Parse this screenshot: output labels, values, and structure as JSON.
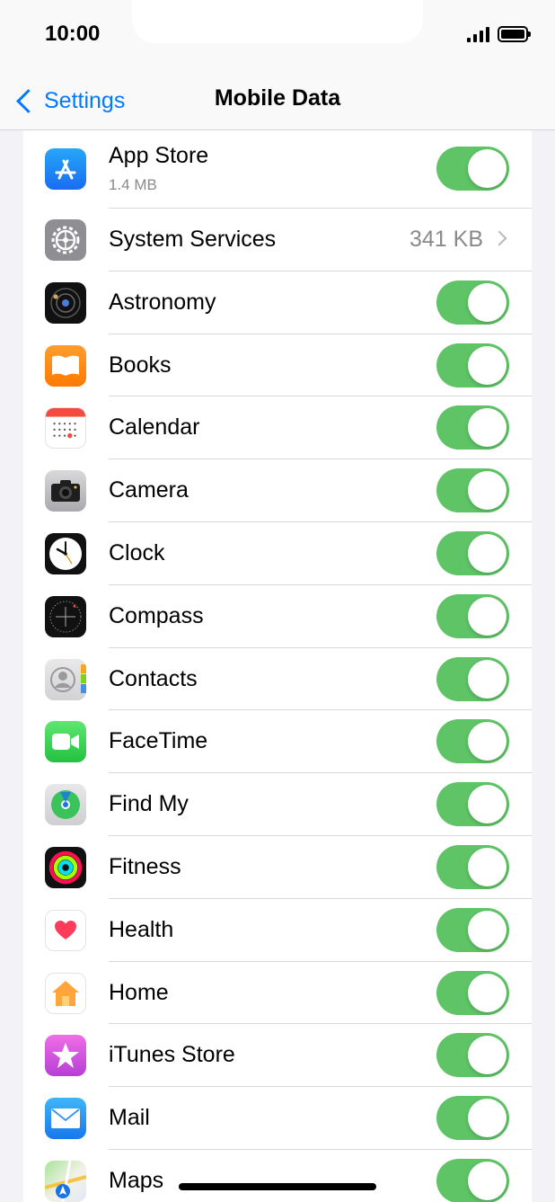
{
  "status_bar": {
    "time": "10:00"
  },
  "nav": {
    "back_label": "Settings",
    "title": "Mobile Data"
  },
  "colors": {
    "accent": "#007aff",
    "toggle_on": "#5ec466",
    "secondary_text": "#8a8a8e"
  },
  "rows": [
    {
      "name": "App Store",
      "subtitle": "1.4 MB",
      "icon": "app-store-icon",
      "control": "toggle",
      "on": true
    },
    {
      "name": "System Services",
      "detail": "341 KB",
      "icon": "system-services-gear-icon",
      "control": "disclosure"
    },
    {
      "name": "Astronomy",
      "icon": "astronomy-icon",
      "control": "toggle",
      "on": true
    },
    {
      "name": "Books",
      "icon": "books-icon",
      "control": "toggle",
      "on": true
    },
    {
      "name": "Calendar",
      "icon": "calendar-icon",
      "control": "toggle",
      "on": true
    },
    {
      "name": "Camera",
      "icon": "camera-icon",
      "control": "toggle",
      "on": true
    },
    {
      "name": "Clock",
      "icon": "clock-icon",
      "control": "toggle",
      "on": true
    },
    {
      "name": "Compass",
      "icon": "compass-icon",
      "control": "toggle",
      "on": true
    },
    {
      "name": "Contacts",
      "icon": "contacts-icon",
      "control": "toggle",
      "on": true
    },
    {
      "name": "FaceTime",
      "icon": "facetime-icon",
      "control": "toggle",
      "on": true
    },
    {
      "name": "Find My",
      "icon": "find-my-icon",
      "control": "toggle",
      "on": true
    },
    {
      "name": "Fitness",
      "icon": "fitness-icon",
      "control": "toggle",
      "on": true
    },
    {
      "name": "Health",
      "icon": "health-icon",
      "control": "toggle",
      "on": true
    },
    {
      "name": "Home",
      "icon": "home-icon",
      "control": "toggle",
      "on": true
    },
    {
      "name": "iTunes Store",
      "icon": "itunes-store-icon",
      "control": "toggle",
      "on": true
    },
    {
      "name": "Mail",
      "icon": "mail-icon",
      "control": "toggle",
      "on": true
    },
    {
      "name": "Maps",
      "icon": "maps-icon",
      "control": "toggle",
      "on": true
    }
  ]
}
